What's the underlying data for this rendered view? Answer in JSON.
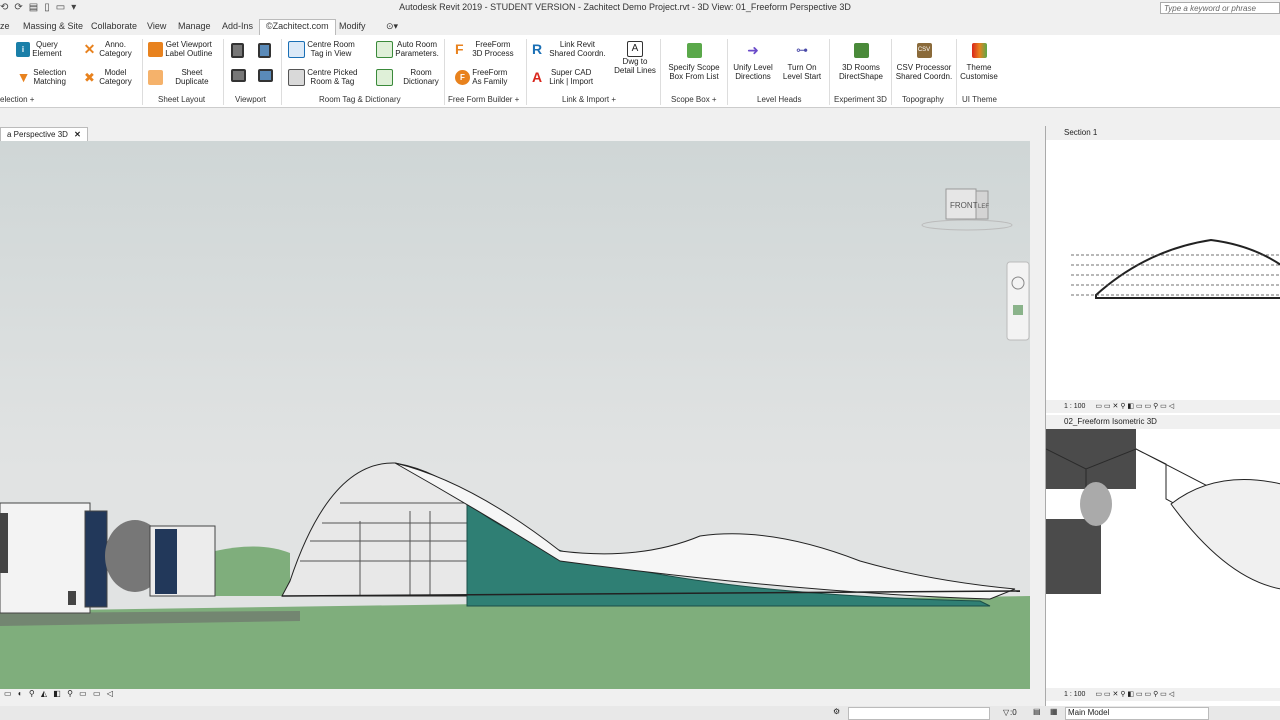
{
  "window": {
    "title": "Autodesk Revit 2019 - STUDENT VERSION - Zachitect Demo Project.rvt - 3D View: 01_Freeform Perspective 3D",
    "search_placeholder": "Type a keyword or phrase"
  },
  "tabs": [
    "ze",
    "Massing & Site",
    "Collaborate",
    "View",
    "Manage",
    "Add-Ins",
    "©Zachitect.com",
    "Modify"
  ],
  "active_tab": "©Zachitect.com",
  "ribbon": {
    "query_element": "Query\nElement",
    "selection_matching": "Selection\nMatching",
    "anno_category": "Anno.\nCategory",
    "model_category": "Model\nCategory",
    "panel_selection": "election +",
    "get_viewport_label": "Get Viewport\nLabel Outline",
    "sheet_duplicate": "Sheet\nDuplicate",
    "panel_sheet_layout": "Sheet Layout",
    "panel_viewport": "Viewport",
    "centre_room_tag": "Centre Room\nTag in View",
    "centre_picked_room": "Centre Picked\nRoom & Tag",
    "auto_room_params": "Auto Room\nParameters.",
    "room_dictionary": "Room\nDictionary",
    "panel_room_tag": "Room Tag & Dictionary",
    "freeform_3d": "FreeForm\n3D Process",
    "freeform_family": "FreeForm\nAs Family",
    "panel_freeform": "Free Form Builder +",
    "link_revit": "Link Revit\nShared Coordn.",
    "super_cad": "Super CAD\nLink | Import",
    "dwg_detail": "Dwg to\nDetail Lines",
    "panel_link": "Link & Import +",
    "specify_scope": "Specify Scope\nBox From List",
    "panel_scope": "Scope Box +",
    "unify_level": "Unify Level\nDirections",
    "turn_on_level": "Turn On\nLevel Start",
    "panel_level": "Level Heads",
    "rooms_3d": "3D Rooms\nDirectShape",
    "panel_experiment": "Experiment 3D",
    "csv_processor": "CSV Processor\nShared Coordn.",
    "panel_topo": "Topography",
    "theme_customise": "Theme\nCustomise",
    "panel_ui": "UI Theme"
  },
  "views": {
    "main_tab": "a Perspective 3D",
    "section_tab": "Section 1",
    "iso_tab": "02_Freeform Isometric 3D",
    "scale_top": "1 : 100",
    "scale_bottom": "1 : 100",
    "viewcube_front": "FRONT",
    "viewcube_left": "LEF"
  },
  "status": {
    "zero": ":0",
    "model": "Main Model"
  },
  "colors": {
    "glass": "#2f7f74",
    "ground": "#7fae7c",
    "accent": "#1a6fb5"
  }
}
